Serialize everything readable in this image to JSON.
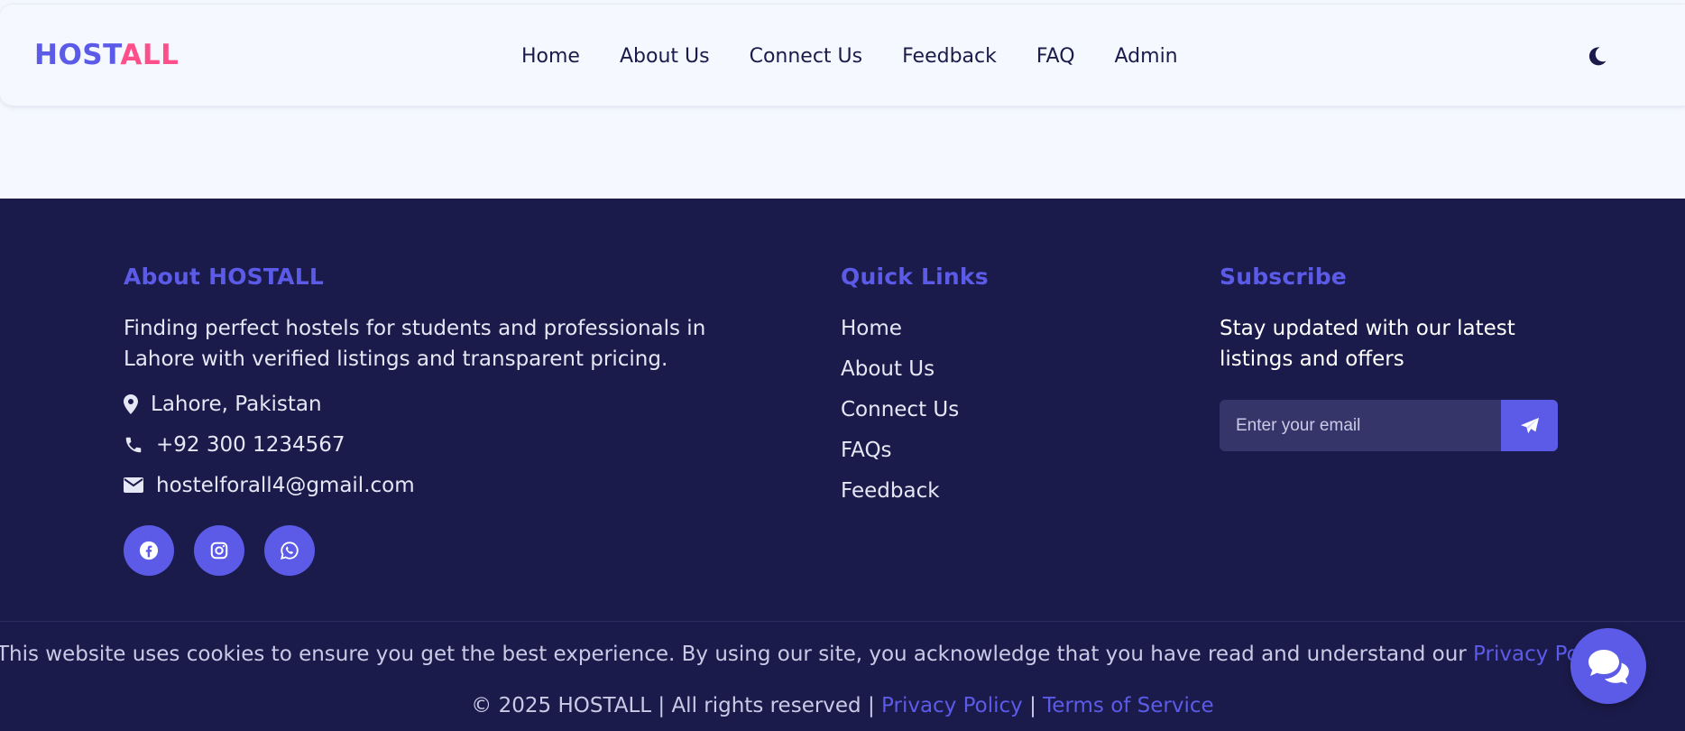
{
  "header": {
    "logo_part1": "HOST",
    "logo_part2": "ALL",
    "nav": [
      "Home",
      "About Us",
      "Connect Us",
      "Feedback",
      "FAQ",
      "Admin"
    ],
    "theme_icon": "moon-icon"
  },
  "footer": {
    "about": {
      "heading": "About HOSTALL",
      "description": "Finding perfect hostels for students and professionals in Lahore with verified listings and transparent pricing.",
      "location": "Lahore, Pakistan",
      "phone": "+92 300 1234567",
      "email": "hostelforall4@gmail.com",
      "socials": [
        "facebook-icon",
        "instagram-icon",
        "whatsapp-icon"
      ]
    },
    "quick_links": {
      "heading": "Quick Links",
      "items": [
        "Home",
        "About Us",
        "Connect Us",
        "FAQs",
        "Feedback"
      ]
    },
    "subscribe": {
      "heading": "Subscribe",
      "text": "Stay updated with our latest listings and offers",
      "placeholder": "Enter your email"
    },
    "cookie": {
      "text": "This website uses cookies to ensure you get the best experience. By using our site, you acknowledge that you have read and understand our ",
      "link": "Privacy Policy",
      "end": "."
    },
    "copyright": {
      "text": "© 2025 HOSTALL | All rights reserved | ",
      "privacy": "Privacy Policy",
      "sep": " | ",
      "terms": "Terms of Service"
    }
  },
  "colors": {
    "primary": "#5b5be8",
    "accent": "#ff4f8b",
    "footer_bg": "#1b1b4b",
    "page_bg": "#f5f8ff"
  }
}
